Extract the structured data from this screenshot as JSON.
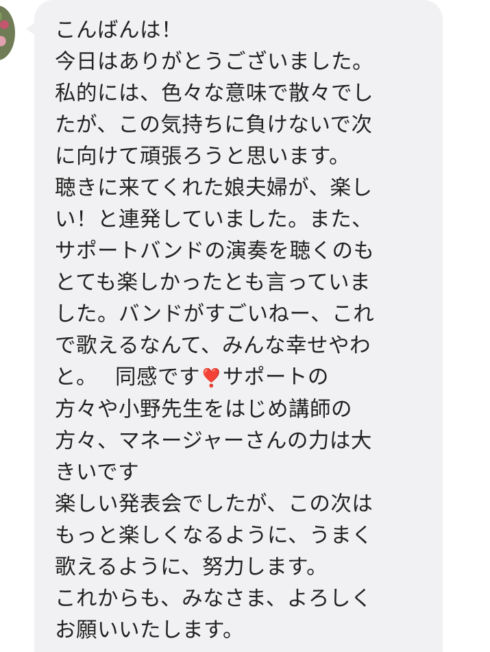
{
  "chat": {
    "avatar_icon": "contact-avatar",
    "bubble_color": "#f1f1f3",
    "text_color": "#222222",
    "message_lines": [
      "こんばんは！",
      "今日はありがとうございました。",
      "私的には、色々な意味で散々でし",
      "たが、この気持ちに負けないで次",
      "に向けて頑張ろうと思います。",
      "聴きに来てくれた娘夫婦が、楽し",
      "い！と連発していました。また、",
      "サポートバンドの演奏を聴くのも",
      "とても楽しかったとも言っていま",
      "した。バンドがすごいねー、これ",
      "で歌えるなんて、みんな幸せやわ"
    ],
    "line_12_before": "と。　 同感です",
    "heart_emoji": "❣️",
    "line_12_after": "サポートの",
    "message_lines_2": [
      "方々や小野先生をはじめ講師の",
      "方々、マネージャーさんの力は大",
      "きいです",
      "楽しい発表会でしたが、この次は",
      "もっと楽しくなるように、うまく",
      "歌えるように、努力します。",
      "これからも、みなさま、よろしく",
      "お願いいたします。"
    ]
  }
}
